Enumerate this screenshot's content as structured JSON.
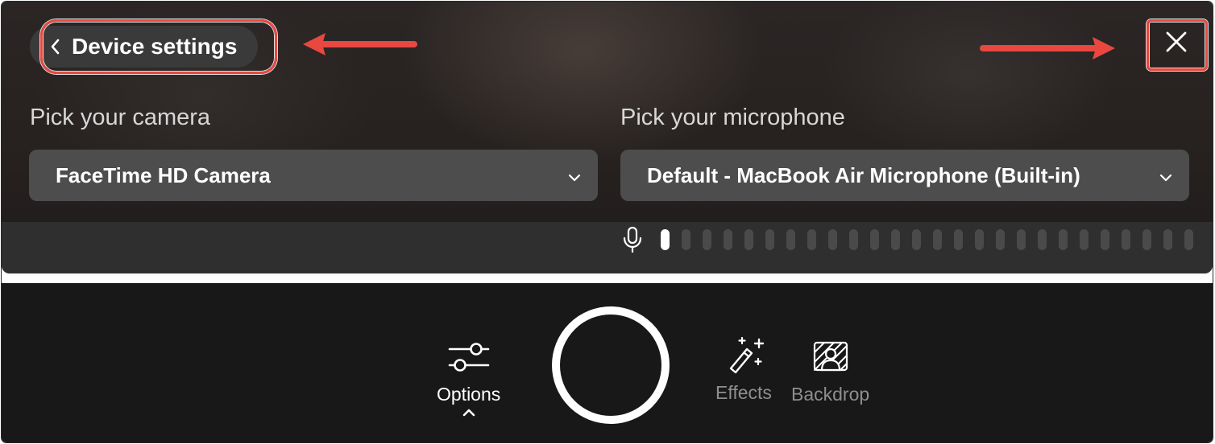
{
  "header": {
    "back_label": "Device settings",
    "icons": {
      "back": "chevron-left-icon",
      "close": "close-icon"
    }
  },
  "camera": {
    "label": "Pick your camera",
    "selected": "FaceTime HD Camera",
    "icon": "chevron-down-icon"
  },
  "microphone": {
    "label": "Pick your microphone",
    "selected": "Default - MacBook Air Microphone (Built-in)",
    "icon": "chevron-down-icon",
    "level_icon": "microphone-icon",
    "level_total_bars": 26,
    "level_active_bars": 1
  },
  "controls": {
    "options_label": "Options",
    "effects_label": "Effects",
    "backdrop_label": "Backdrop",
    "icons": {
      "options": "sliders-icon",
      "options_expand": "chevron-up-icon",
      "record": "record-circle-icon",
      "effects": "magic-wand-icon",
      "backdrop": "backdrop-person-icon"
    }
  },
  "colors": {
    "annotation": "#e8483f",
    "panel_background": "#2b2625",
    "select_background": "#4d4d4e",
    "control_bar_background": "#181818",
    "disabled_text": "#8e8e8e"
  }
}
